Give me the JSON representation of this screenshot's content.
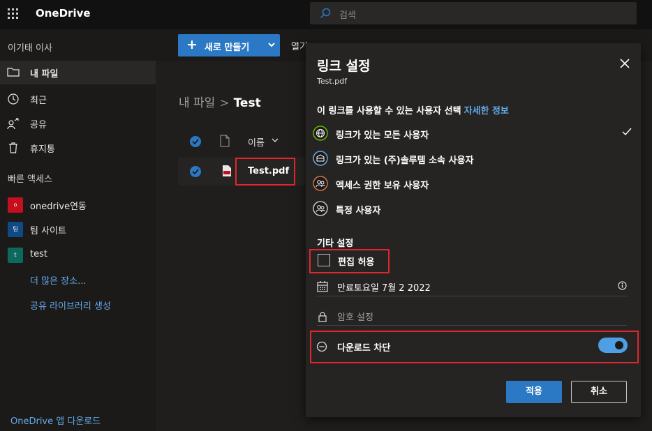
{
  "app": {
    "title": "OneDrive",
    "search_placeholder": "검색",
    "waffle_icon": "app-launcher-icon"
  },
  "sidebar": {
    "user_name": "이기태 이사",
    "nav": [
      {
        "label": "내 파일",
        "icon": "folder-icon",
        "active": true
      },
      {
        "label": "최근",
        "icon": "history-icon"
      },
      {
        "label": "공유",
        "icon": "people-share-icon"
      },
      {
        "label": "휴지통",
        "icon": "recycle-bin-icon"
      }
    ],
    "quick_access_title": "빠른 액세스",
    "libraries": [
      {
        "label": "onedrive연동",
        "color": "#c50f1f",
        "initial": "o"
      },
      {
        "label": "팀 사이트",
        "color": "#0f4a85",
        "initial": "팀"
      },
      {
        "label": "test",
        "color": "#0b6a5b",
        "initial": "t"
      }
    ],
    "more_places": "더 많은 장소...",
    "create_library": "공유 라이브러리 생성",
    "app_download": "OneDrive 앱 다운로드"
  },
  "commands": {
    "new_label": "새로 만들기",
    "open_label": "열기"
  },
  "breadcrumb": {
    "root": "내 파일",
    "current": "Test"
  },
  "file_list": {
    "name_header": "이름",
    "files": [
      {
        "name": "Test.pdf",
        "icon": "pdf-file-icon",
        "selected": true
      }
    ]
  },
  "link_settings": {
    "title": "링크 설정",
    "file_name": "Test.pdf",
    "question": "이 링크를 사용할 수 있는 사용자 선택",
    "learn_more": "자세한 정보",
    "options": [
      {
        "label": "링크가 있는 모든 사용자",
        "icon": "globe-icon",
        "ring": "#6bb700",
        "selected": true
      },
      {
        "label": "링크가 있는 (주)솔루템 소속 사용자",
        "icon": "building-icon",
        "ring": "#63a9e8",
        "selected": false
      },
      {
        "label": "액세스 권한 보유 사용자",
        "icon": "people-icon",
        "ring": "#c8764a",
        "selected": false
      },
      {
        "label": "특정 사용자",
        "icon": "people-icon",
        "ring": "#c8c6c4",
        "selected": false
      }
    ],
    "other_settings_title": "기타 설정",
    "allow_edit_label": "편집 허용",
    "allow_edit_checked": false,
    "expiry_text": "만료토요일 7월 2 2022",
    "password_placeholder": "암호 설정",
    "block_download_label": "다운로드 차단",
    "block_download_on": true,
    "apply_label": "적용",
    "cancel_label": "취소"
  },
  "colors": {
    "accent": "#2b78c4",
    "highlight_box": "#e0262e"
  }
}
